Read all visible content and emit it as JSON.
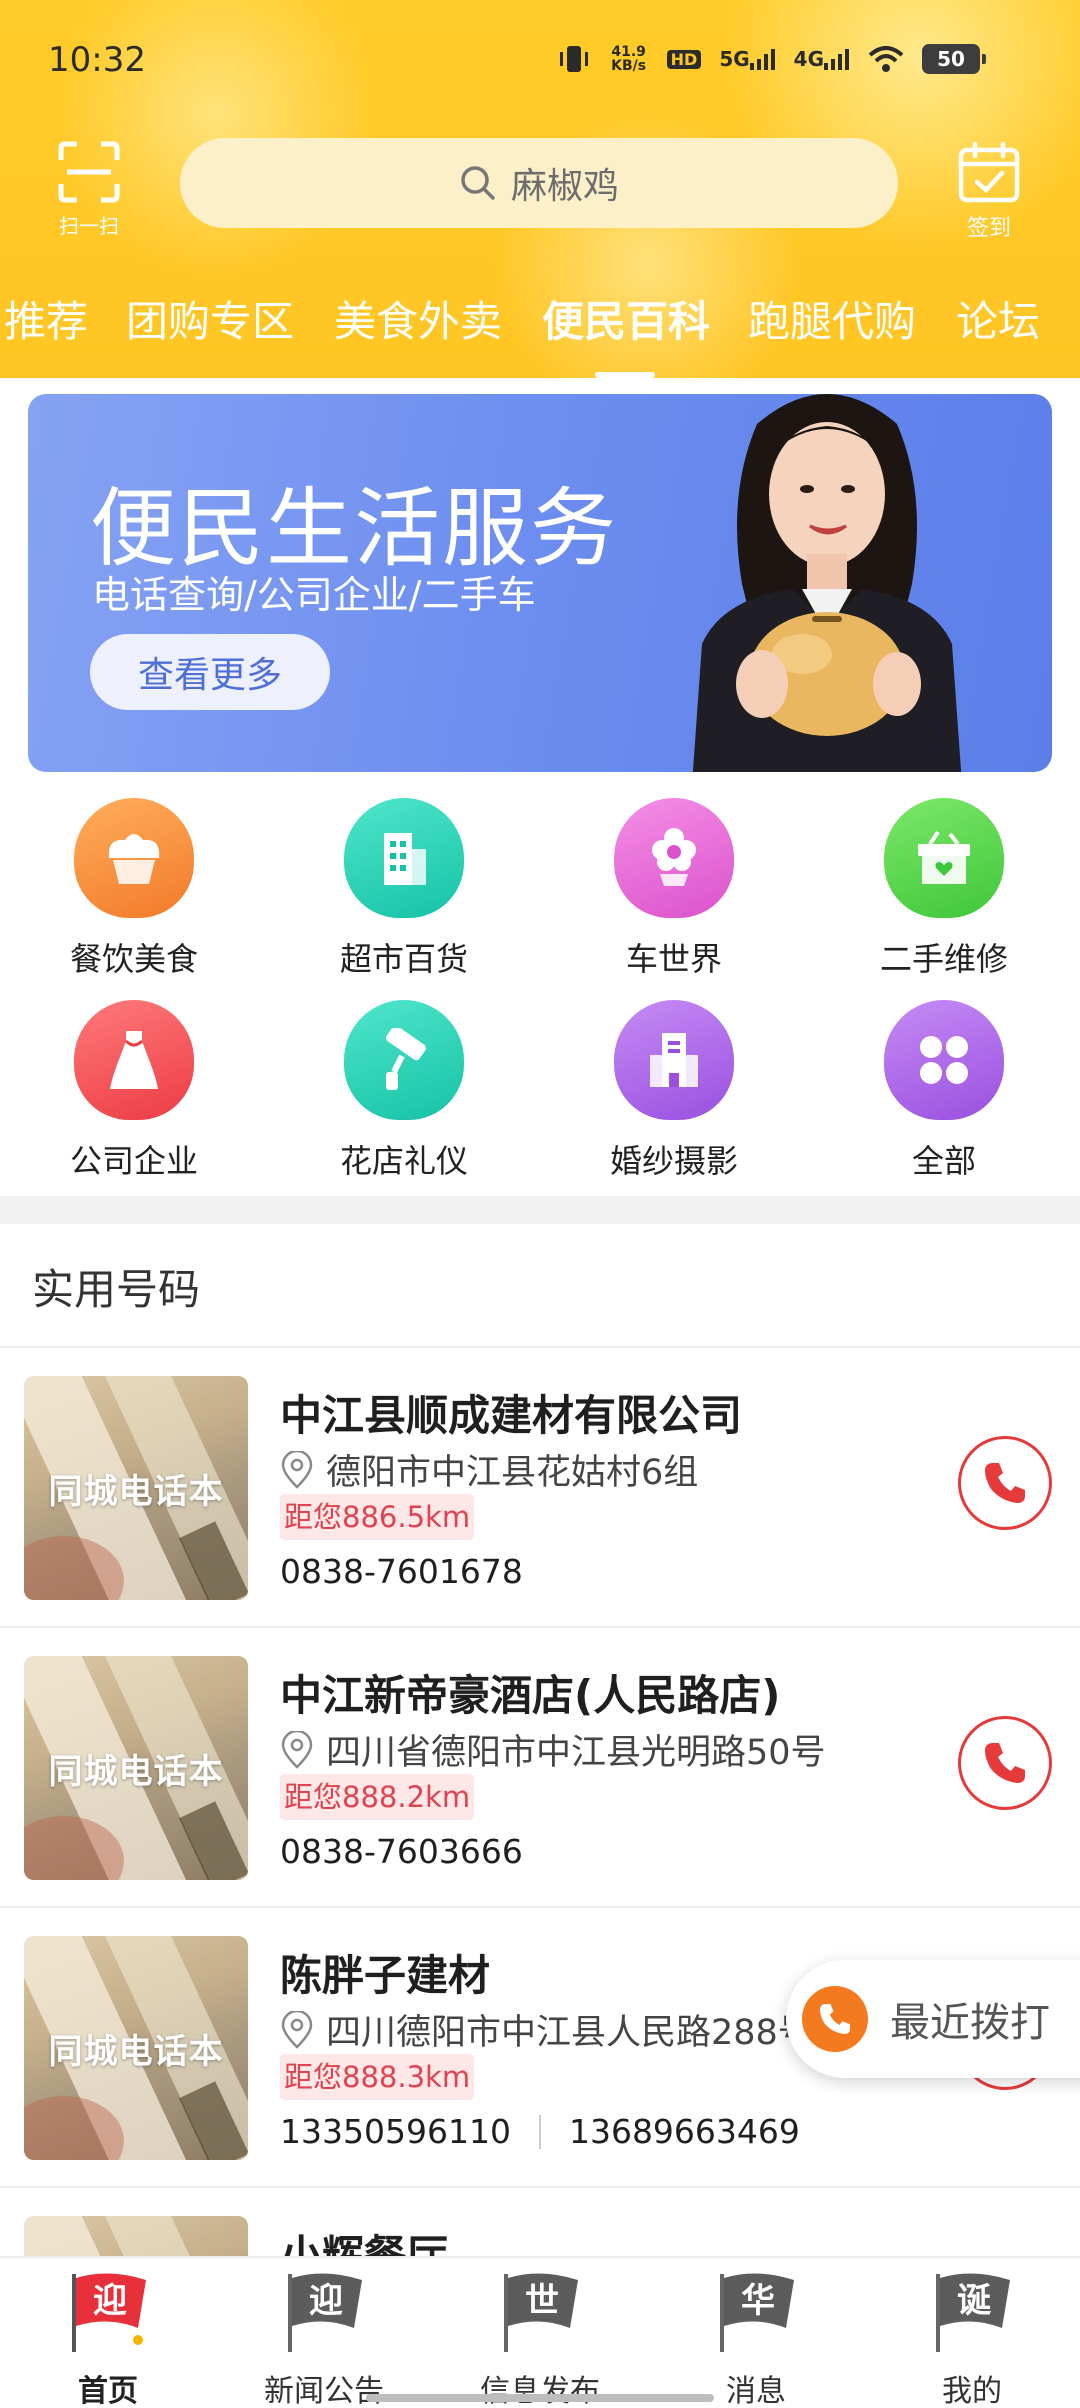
{
  "status_bar": {
    "time": "10:32",
    "net_speed": "41.9 KB/s",
    "hd": "HD",
    "sig1": "5G",
    "sig2": "4G",
    "battery": "50"
  },
  "header": {
    "scan_label": "扫一扫",
    "search_placeholder": "麻椒鸡",
    "checkin_label": "签到",
    "tabs": [
      {
        "label": "推荐"
      },
      {
        "label": "团购专区"
      },
      {
        "label": "美食外卖"
      },
      {
        "label": "便民百科"
      },
      {
        "label": "跑腿代购"
      },
      {
        "label": "论坛"
      }
    ],
    "active_tab": "便民百科"
  },
  "banner": {
    "title": "便民生活服务",
    "subtitle": "电话查询/公司企业/二手车",
    "button": "查看更多"
  },
  "categories": [
    {
      "label": "餐饮美食",
      "icon": "cupcake-icon",
      "color": "#f7893a"
    },
    {
      "label": "超市百货",
      "icon": "building-icon",
      "color": "#22cfb3"
    },
    {
      "label": "车世界",
      "icon": "flower-icon",
      "color": "#e86bd7"
    },
    {
      "label": "二手维修",
      "icon": "gift-box-icon",
      "color": "#57d44a"
    },
    {
      "label": "公司企业",
      "icon": "dress-icon",
      "color": "#f0434a"
    },
    {
      "label": "花店礼仪",
      "icon": "paint-roller-icon",
      "color": "#22cfb3"
    },
    {
      "label": "婚纱摄影",
      "icon": "office-building-icon",
      "color": "#a45de6"
    },
    {
      "label": "全部",
      "icon": "four-petal-icon",
      "color": "#a45de6"
    }
  ],
  "section_title": "实用号码",
  "thumb_label": "同城电话本",
  "entries": [
    {
      "name": "中江县顺成建材有限公司",
      "address": "德阳市中江县花姑村6组",
      "distance": "距您886.5km",
      "phones": [
        "0838-7601678"
      ]
    },
    {
      "name": "中江新帝豪酒店(人民路店)",
      "address": "四川省德阳市中江县光明路50号",
      "distance": "距您888.2km",
      "phones": [
        "0838-7603666"
      ]
    },
    {
      "name": "陈胖子建材",
      "address": "四川德阳市中江县人民路288号",
      "distance": "距您888.3km",
      "phones": [
        "13350596110",
        "13689663469"
      ]
    },
    {
      "name": "小辉餐厅",
      "address": "",
      "distance": "",
      "phones": []
    }
  ],
  "recent_calls": "最近拨打",
  "bottom_nav": [
    {
      "label": "首页",
      "char": "迎",
      "active": true
    },
    {
      "label": "新闻公告",
      "char": "迎",
      "active": false
    },
    {
      "label": "信息发布",
      "char": "世",
      "active": false
    },
    {
      "label": "消息",
      "char": "华",
      "active": false
    },
    {
      "label": "我的",
      "char": "诞",
      "active": false
    }
  ],
  "colors": {
    "header": "#ffc524",
    "accent_red": "#e63a3a",
    "banner_blue": "#6e8ff0"
  }
}
